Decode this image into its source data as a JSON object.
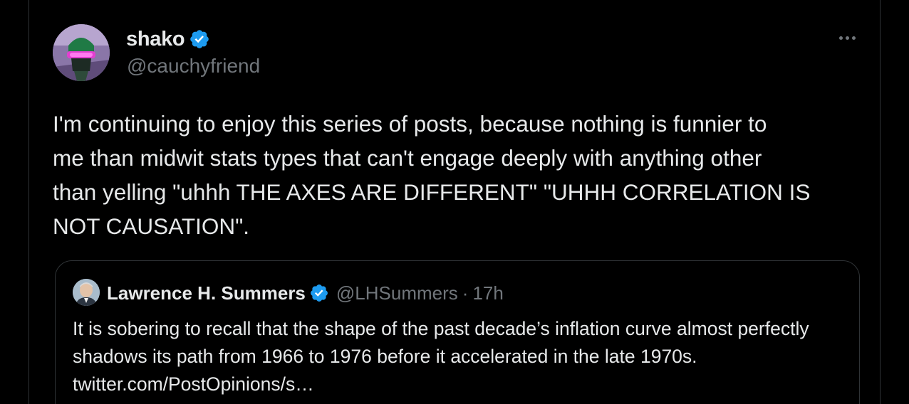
{
  "tweet": {
    "author": {
      "display_name": "shako",
      "handle": "@cauchyfriend",
      "verified": true,
      "avatar_icon": "masked-figure-avatar"
    },
    "more_icon": "ellipsis-icon",
    "text": "I'm continuing to enjoy this series of posts, because nothing is funnier to\nme than midwit stats types that can't engage deeply with anything other\nthan yelling \"uhhh THE AXES ARE DIFFERENT\" \"UHHH CORRELATION IS\nNOT CAUSATION\".",
    "quote": {
      "author": {
        "display_name": "Lawrence H. Summers",
        "handle": "@LHSummers",
        "verified": true,
        "avatar_icon": "person-photo-avatar"
      },
      "separator": "·",
      "time": "17h",
      "text": "It is sobering to recall that the shape of the past decade’s inflation curve almost perfectly shadows its path from 1966 to 1976 before it accelerated in the late 1970s.  twitter.com/PostOpinions/s…"
    }
  },
  "colors": {
    "background": "#000000",
    "text_primary": "#e7e9ea",
    "text_secondary": "#71767b",
    "border": "#2f3336",
    "verified_badge": "#1d9bf0"
  }
}
